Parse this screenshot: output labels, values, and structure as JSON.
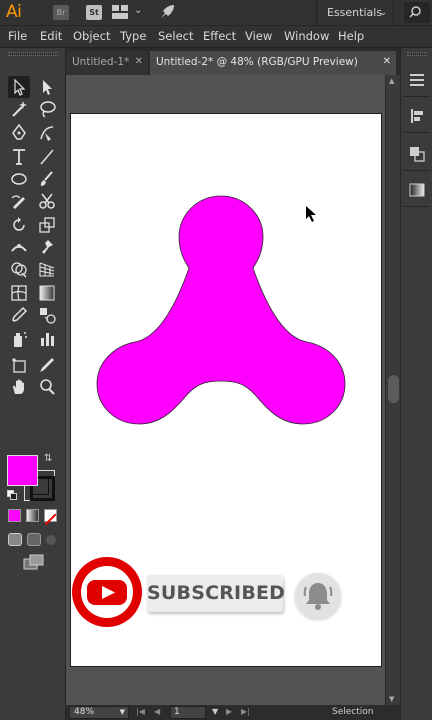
{
  "app": {
    "logo": "Ai",
    "bridge_label": "Br",
    "stock_label": "St",
    "workspace": "Essentials"
  },
  "menu": {
    "items": [
      "File",
      "Edit",
      "Object",
      "Type",
      "Select",
      "Effect",
      "View",
      "Window",
      "Help"
    ]
  },
  "tabs": [
    {
      "label": "Untitled-1*"
    },
    {
      "label": "Untitled-2* @ 48% (RGB/GPU Preview)"
    }
  ],
  "colors": {
    "fill": "#ff00ff",
    "accent": "#ff9a00",
    "youtube_red": "#e00000"
  },
  "canvas": {
    "subscribe_label": "SUBSCRIBED",
    "shape": "magenta-tri-lobe-shape",
    "youtube_icon": "youtube-icon",
    "bell_icon": "bell-icon"
  },
  "status": {
    "zoom": "48%",
    "page": "1",
    "current_tool": "Selection"
  }
}
